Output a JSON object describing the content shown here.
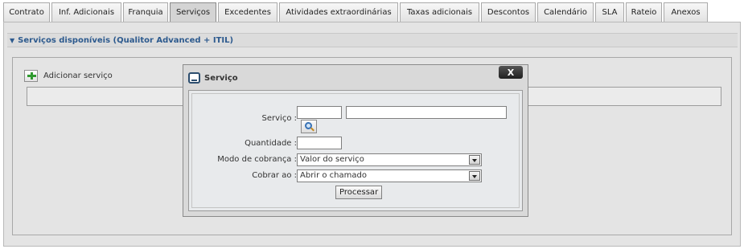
{
  "tabs": [
    {
      "label": "Contrato"
    },
    {
      "label": "Inf. Adicionais"
    },
    {
      "label": "Franquia"
    },
    {
      "label": "Serviços",
      "active": true
    },
    {
      "label": "Excedentes"
    },
    {
      "label": "Atividades extraordinárias"
    },
    {
      "label": "Taxas adicionais"
    },
    {
      "label": "Descontos"
    },
    {
      "label": "Calendário"
    },
    {
      "label": "SLA"
    },
    {
      "label": "Rateio"
    },
    {
      "label": "Anexos"
    }
  ],
  "section": {
    "title": "Serviços disponíveis (Qualitor Advanced + ITIL)",
    "add_label": "Adicionar serviço"
  },
  "modal": {
    "title": "Serviço",
    "close_label": "X",
    "fields": {
      "servico_label": "Serviço :",
      "servico_code": "",
      "servico_name": "",
      "quantidade_label": "Quantidade :",
      "quantidade_value": "",
      "modo_label": "Modo de cobrança :",
      "modo_value": "Valor do serviço",
      "cobrar_label": "Cobrar ao :",
      "cobrar_value": "Abrir o chamado"
    },
    "process_label": "Processar"
  },
  "icons": {
    "add": "plus-icon",
    "lookup": "magnifier-icon",
    "modal": "chat-bubble-icon",
    "close": "close-icon",
    "dropdown": "chevron-down-icon"
  }
}
